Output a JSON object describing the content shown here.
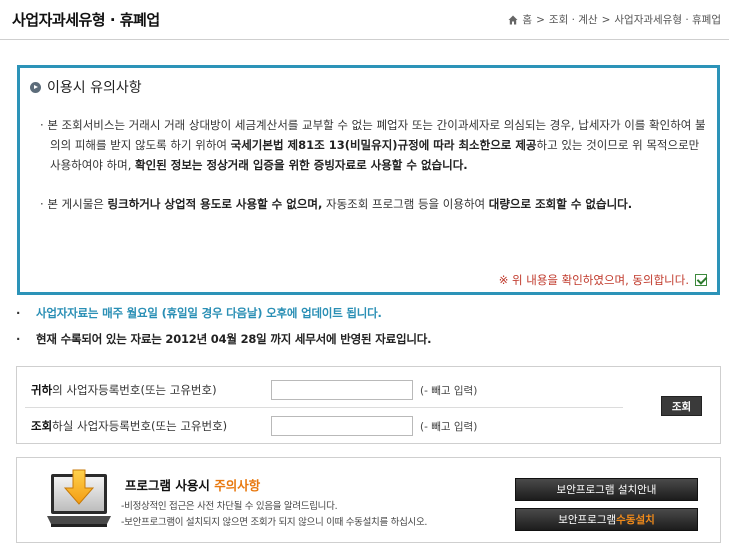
{
  "header": {
    "title": "사업자과세유형 · 휴폐업",
    "breadcrumb": [
      "홈",
      "조회 · 계산",
      "사업자과세유형 · 휴폐업"
    ],
    "separator": ">"
  },
  "notice": {
    "title": "이용시 유의사항",
    "para1": {
      "t1": "본 조회서비스는 거래시 거래 상대방이 세금계산서를 교부할 수 없는 폐업자 또는 간이과세자로 의심되는 경우, 납세자가 이를 확인하여 불의의 피해를 받지 않도록 하기 위하여 ",
      "b1": "국세기본법 제81조 13(비밀유지)규정에 따라 최소한으로 제공",
      "t2": "하고 있는 것이므로 위 목적으로만 사용하여야 하며, ",
      "b2": "확인된 정보는 정상거래 입증을 위한 증빙자료로 사용할 수 없습니다."
    },
    "para2": {
      "t1": "본 게시물은 ",
      "b1": "링크하거나 상업적 용도로 사용할 수 없으며,",
      "t2": " 자동조회 프로그램 등을 이용하여 ",
      "b2": "대량으로 조회할 수 없습니다."
    },
    "agree_text": "※ 위 내용을 확인하였으며, 동의합니다.",
    "agree_checked": true
  },
  "info": {
    "line1": "사업자자료는 매주 월요일 (휴일일 경우 다음날) 오후에 업데이트 됩니다.",
    "line2": "현재 수록되어 있는 자료는 2012년 04월 28일 까지 세무서에 반영된 자료입니다.",
    "dot": "·"
  },
  "lookup": {
    "row1_bold": "귀하",
    "row1_rest": "의 사업자등록번호(또는 고유번호)",
    "row2_bold": "조회",
    "row2_rest": "하실 사업자등록번호(또는 고유번호)",
    "hint": "(- 빼고 입력)",
    "row1_value": "",
    "row2_value": "",
    "button": "조회"
  },
  "program": {
    "title_main": "프로그램 사용시 ",
    "title_accent": "주의사항",
    "note1": "-비정상적인 접근은 사전 차단될 수 있음을 알려드립니다.",
    "note2": "-보안프로그램이 설치되지 않으면 조회가 되지 않으니 이때 수동설치를 하십시오.",
    "btn1": "보안프로그램 설치안내",
    "btn2_main": "보안프로그램 ",
    "btn2_accent": "수동설치"
  },
  "colors": {
    "notice_border": "#2c93b8",
    "info_highlight": "#2a8fb5",
    "agree_text": "#c0392b",
    "accent_orange": "#e8780e"
  }
}
